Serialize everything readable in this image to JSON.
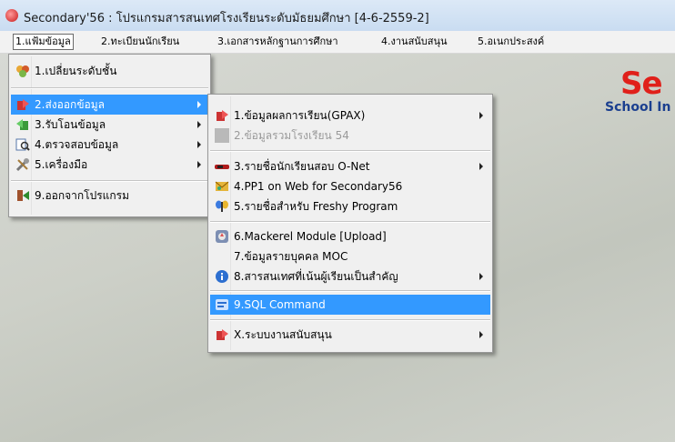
{
  "window": {
    "title": "Secondary'56 : โปรแกรมสารสนเทศโรงเรียนระดับมัธยมศึกษา [4-6-2559-2]"
  },
  "menubar": [
    "1.แฟ้มข้อมูล",
    "2.ทะเบียนนักเรียน",
    "3.เอกสารหลักฐานการศึกษา",
    "4.งานสนับสนุน",
    "5.อเนกประสงค์"
  ],
  "logo": {
    "text": "Se",
    "subtext": "School In"
  },
  "file_menu": {
    "items": [
      {
        "label": "1.เปลี่ยนระดับชั้น",
        "icon": "level-change-icon",
        "submenu": false
      },
      {
        "label": "2.ส่งออกข้อมูล",
        "icon": "export-arrow-icon",
        "submenu": true,
        "highlighted": true
      },
      {
        "label": "3.รับโอนข้อมูล",
        "icon": "import-arrow-icon",
        "submenu": true
      },
      {
        "label": "4.ตรวจสอบข้อมูล",
        "icon": "check-data-icon",
        "submenu": true
      },
      {
        "label": "5.เครื่องมือ",
        "icon": "tools-icon",
        "submenu": true
      },
      {
        "label": "9.ออกจากโปรแกรม",
        "icon": "exit-icon",
        "submenu": false
      }
    ]
  },
  "export_submenu": {
    "items": [
      {
        "label": "1.ข้อมูลผลการเรียน(GPAX)",
        "icon": "export-arrow-icon",
        "submenu": true
      },
      {
        "label": "2.ข้อมูลรวมโรงเรียน 54",
        "icon": "disabled-icon",
        "submenu": false,
        "disabled": true
      },
      {
        "label": "3.รายชื่อนักเรียนสอบ O-Net",
        "icon": "onet-icon",
        "submenu": true
      },
      {
        "label": "4.PP1 on Web for Secondary56",
        "icon": "web-envelope-icon",
        "submenu": false
      },
      {
        "label": "5.รายชื่อสำหรับ Freshy Program",
        "icon": "butterfly-icon",
        "submenu": false
      },
      {
        "label": "6.Mackerel Module [Upload]",
        "icon": "upload-module-icon",
        "submenu": false
      },
      {
        "label": "7.ข้อมูลรายบุคคล MOC",
        "icon": "",
        "submenu": false
      },
      {
        "label": "8.สารสนเทศที่เน้นผู้เรียนเป็นสำคัญ",
        "icon": "info-icon",
        "submenu": true
      },
      {
        "label": "9.SQL Command",
        "icon": "sql-icon",
        "submenu": false,
        "highlighted": true
      },
      {
        "label": "X.ระบบงานสนับสนุน",
        "icon": "export-arrow-icon",
        "submenu": true
      }
    ]
  },
  "colors": {
    "highlight": "#3399ff",
    "logo_red": "#e0201a",
    "logo_blue": "#1b3f8f"
  }
}
